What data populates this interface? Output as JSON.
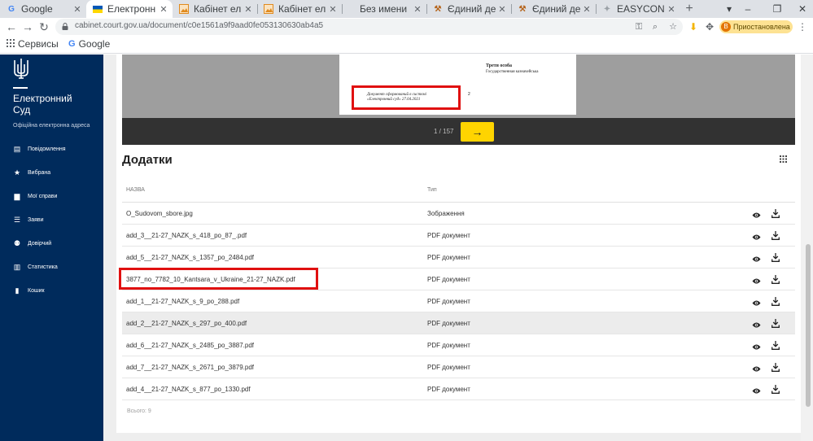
{
  "browser": {
    "tabs": [
      {
        "title": "Google",
        "favicon": "G",
        "active": false
      },
      {
        "title": "Електронн",
        "favicon": "ua-flag",
        "active": true
      },
      {
        "title": "Кабінет ел",
        "favicon": "image",
        "active": false
      },
      {
        "title": "Кабінет ел",
        "favicon": "image",
        "active": false
      },
      {
        "title": "Без имени",
        "favicon": "",
        "active": false
      },
      {
        "title": "Єдиний де",
        "favicon": "gavel",
        "active": false
      },
      {
        "title": "Єдиний де",
        "favicon": "gavel",
        "active": false
      },
      {
        "title": "EASYCON",
        "favicon": "easycon",
        "active": false
      }
    ],
    "address": "cabinet.court.gov.ua/document/c0e1561a9f9aad0fe053130630ab4a5",
    "paused_label": "Приостановлена",
    "profile_initial": "B",
    "bookmarks": [
      {
        "label": "Сервисы",
        "icon": "apps-icon"
      },
      {
        "label": "Google",
        "icon": "google-icon"
      }
    ]
  },
  "sidebar": {
    "brand": "Електронний Суд",
    "subtitle": "Офіційна електронна адреса",
    "items": [
      {
        "label": "Повідомлення",
        "icon": "message-icon"
      },
      {
        "label": "Вибрана",
        "icon": "star-icon"
      },
      {
        "label": "Мої справи",
        "icon": "folder-icon"
      },
      {
        "label": "Заяви",
        "icon": "list-icon"
      },
      {
        "label": "Довірчий",
        "icon": "people-icon"
      },
      {
        "label": "Статистика",
        "icon": "stats-icon"
      },
      {
        "label": "Кошик",
        "icon": "trash-icon"
      }
    ]
  },
  "viewer": {
    "doc_party": "Третя особа",
    "doc_party_name": "Государственная казначейська",
    "stamp_line1": "Документ сформований в системі",
    "stamp_line2": "«Електронний суд» 27.04.2021",
    "page_number": "2",
    "page_counter": "1 / 157",
    "next_label": "→"
  },
  "attachments": {
    "title": "Додатки",
    "columns": {
      "name": "НАЗВА",
      "type": "Тип"
    },
    "rows": [
      {
        "name": "O_Sudovom_sbore.jpg",
        "type": "Зображення"
      },
      {
        "name": "add_3__21-27_NAZK_s_418_po_87_.pdf",
        "type": "PDF документ"
      },
      {
        "name": "add_5__21-27_NAZK_s_1357_po_2484.pdf",
        "type": "PDF документ"
      },
      {
        "name": "3877_no_7782_10_Kantsara_v_Ukraine_21-27_NAZK.pdf",
        "type": "PDF документ"
      },
      {
        "name": "add_1__21-27_NAZK_s_9_po_288.pdf",
        "type": "PDF документ"
      },
      {
        "name": "add_2__21-27_NAZK_s_297_po_400.pdf",
        "type": "PDF документ"
      },
      {
        "name": "add_6__21-27_NAZK_s_2485_po_3887.pdf",
        "type": "PDF документ"
      },
      {
        "name": "add_7__21-27_NAZK_s_2671_po_3879.pdf",
        "type": "PDF документ"
      },
      {
        "name": "add_4__21-27_NAZK_s_877_po_1330.pdf",
        "type": "PDF документ"
      }
    ],
    "total": "Всього: 9"
  },
  "colors": {
    "sidebar_bg": "#002b5c",
    "accent_yellow": "#ffd400",
    "highlight_red": "#e01010"
  }
}
